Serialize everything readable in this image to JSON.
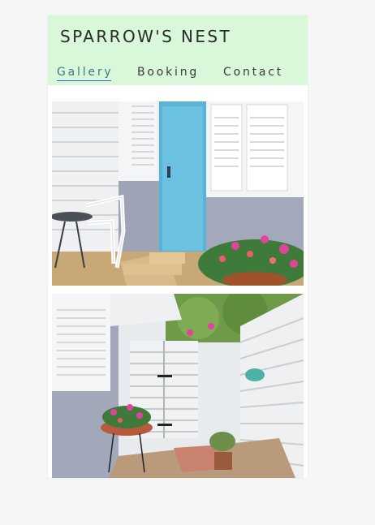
{
  "site": {
    "title": "SPARROW'S NEST"
  },
  "nav": {
    "items": [
      {
        "label": "Gallery",
        "active": true
      },
      {
        "label": "Booking",
        "active": false
      },
      {
        "label": "Contact",
        "active": false
      }
    ]
  },
  "gallery": {
    "photos": [
      {
        "subject": "porch with white chair, blue door, flowers"
      },
      {
        "subject": "courtyard with wooden gate and potted flowers"
      }
    ]
  },
  "colors": {
    "header_bg": "#d9f7d9",
    "page_bg": "#f5f6f6",
    "active_underline": "#3b5bd9"
  }
}
